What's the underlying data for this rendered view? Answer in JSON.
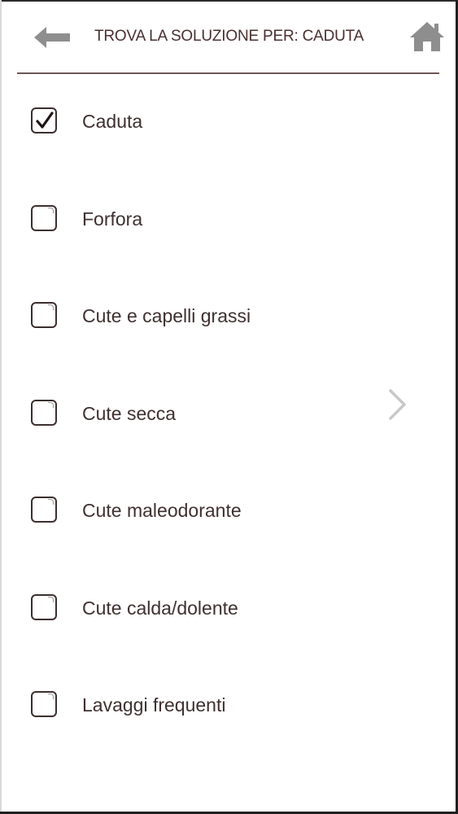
{
  "header": {
    "title": "TROVA LA SOLUZIONE PER: CADUTA",
    "back_icon": "arrow-left-icon",
    "home_icon": "home-icon"
  },
  "colors": {
    "text": "#3f3030",
    "title": "#4a2f2f",
    "divider": "#6d5656",
    "icon_gray": "#8e8e8e",
    "chevron_gray": "#c8c8c8"
  },
  "items": [
    {
      "label": "Caduta",
      "checked": true
    },
    {
      "label": "Forfora",
      "checked": false
    },
    {
      "label": "Cute e capelli grassi",
      "checked": false
    },
    {
      "label": "Cute secca",
      "checked": false
    },
    {
      "label": "Cute maleodorante",
      "checked": false
    },
    {
      "label": "Cute calda/dolente",
      "checked": false
    },
    {
      "label": "Lavaggi frequenti",
      "checked": false
    }
  ],
  "chevron_icon": "chevron-right-icon"
}
